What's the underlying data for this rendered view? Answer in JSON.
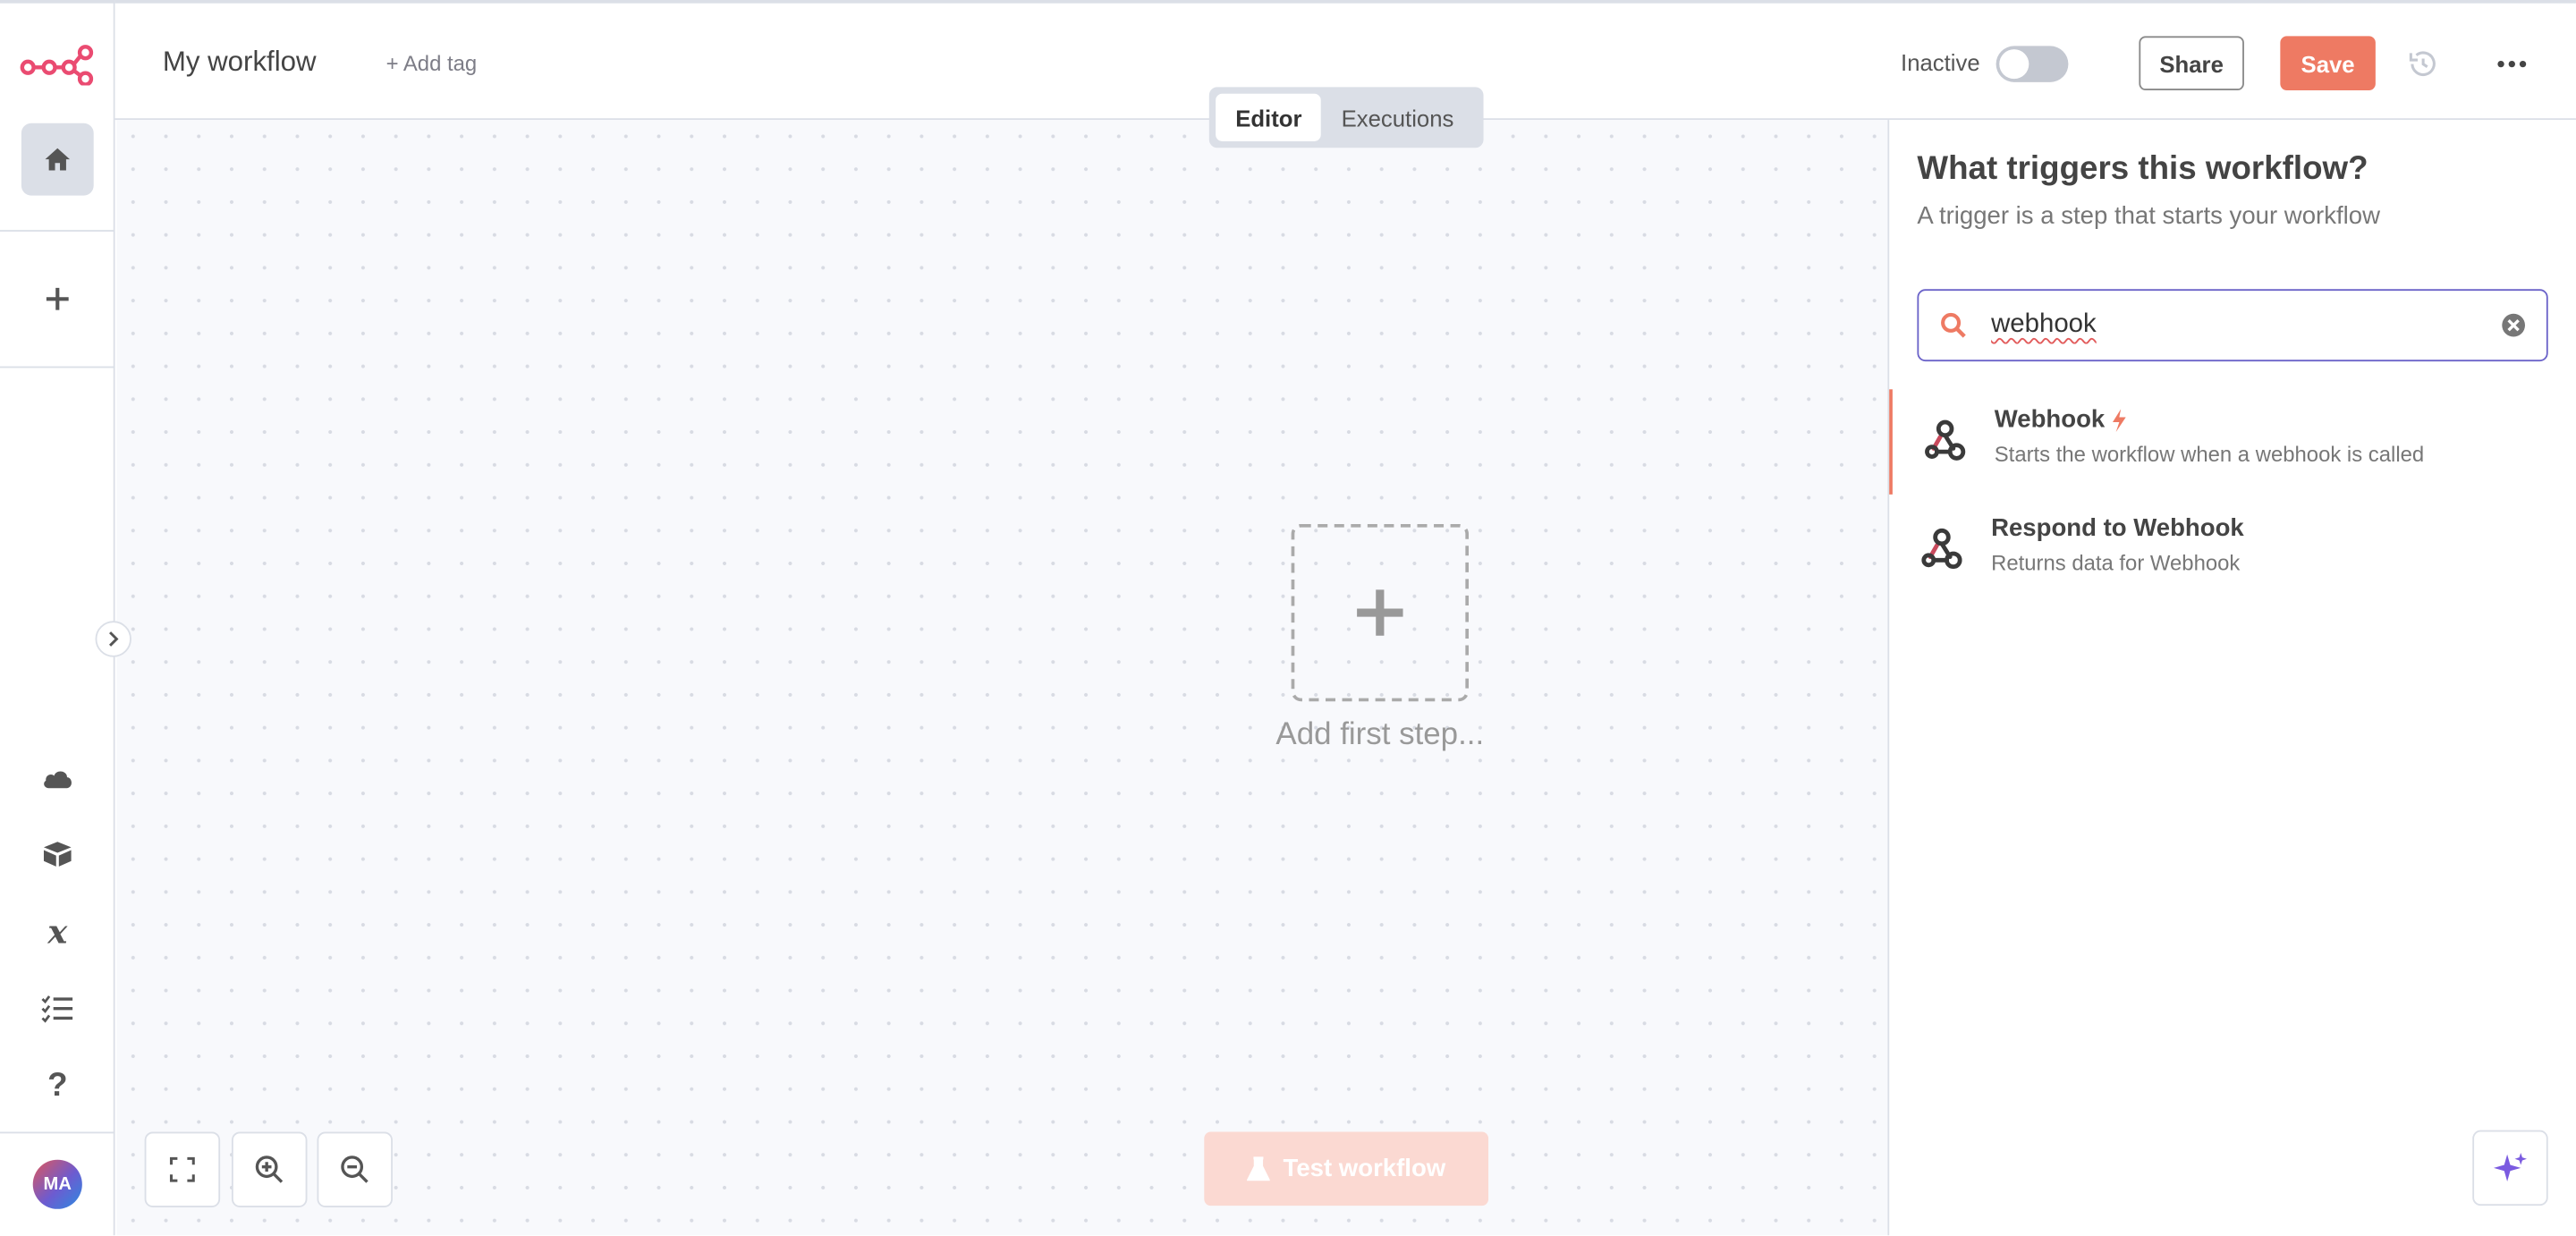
{
  "header": {
    "workflow_name": "My workflow",
    "add_tag_label": "+ Add tag",
    "active_status_label": "Inactive",
    "active": false,
    "share_label": "Share",
    "save_label": "Save"
  },
  "tabs": [
    {
      "label": "Editor",
      "active": true
    },
    {
      "label": "Executions",
      "active": false
    }
  ],
  "sidebar": {
    "top_items": [
      {
        "name": "home",
        "icon": "home-icon",
        "active": true
      },
      {
        "name": "create",
        "icon": "plus-icon",
        "active": false
      }
    ],
    "bottom_items": [
      {
        "name": "cloud",
        "icon": "cloud-icon"
      },
      {
        "name": "templates",
        "icon": "box-icon"
      },
      {
        "name": "variables",
        "icon": "variable-x-icon"
      },
      {
        "name": "executions",
        "icon": "checklist-icon"
      },
      {
        "name": "help",
        "icon": "question-icon"
      }
    ],
    "avatar_initials": "MA"
  },
  "canvas": {
    "add_first_step_label": "Add first step...",
    "test_workflow_label": "Test workflow",
    "controls": [
      "fit-view-icon",
      "zoom-in-icon",
      "zoom-out-icon"
    ]
  },
  "node_panel": {
    "title": "What triggers this workflow?",
    "subtitle": "A trigger is a step that starts your workflow",
    "search_value": "webhook",
    "results": [
      {
        "name": "Webhook",
        "description": "Starts the workflow when a webhook is called",
        "trigger_badge": true,
        "selected": true
      },
      {
        "name": "Respond to Webhook",
        "description": "Returns data for Webhook",
        "trigger_badge": false,
        "selected": false
      }
    ]
  },
  "colors": {
    "accent": "#ee7a63",
    "search_border": "#6b63c9",
    "sidebar_active": "#dbdfe7",
    "canvas_bg": "#f8f9fc"
  }
}
